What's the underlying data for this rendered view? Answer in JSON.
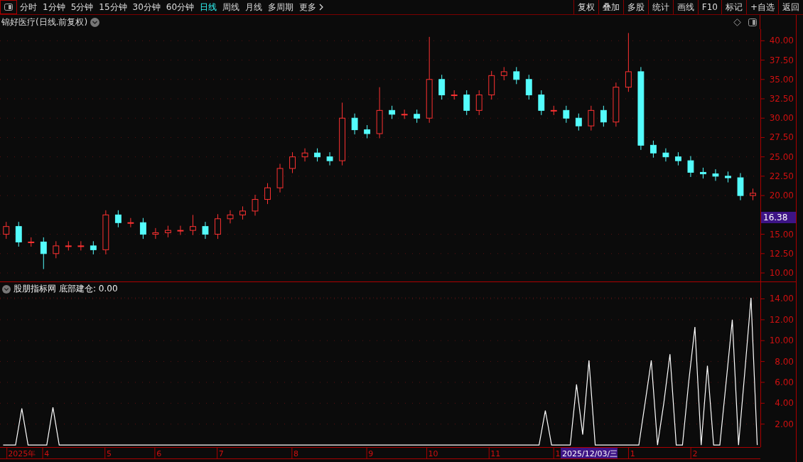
{
  "toolbar": {
    "tabs": [
      {
        "label": "分时",
        "selected": false,
        "kind": "tab"
      },
      {
        "label": "1分钟",
        "selected": false,
        "kind": "tab"
      },
      {
        "label": "5分钟",
        "selected": false,
        "kind": "tab"
      },
      {
        "label": "15分钟",
        "selected": false,
        "kind": "tab"
      },
      {
        "label": "30分钟",
        "selected": false,
        "kind": "tab"
      },
      {
        "label": "60分钟",
        "selected": false,
        "kind": "tab"
      },
      {
        "label": "日线",
        "selected": true,
        "kind": "tab"
      },
      {
        "label": "周线",
        "selected": false,
        "kind": "tab"
      },
      {
        "label": "月线",
        "selected": false,
        "kind": "tab"
      },
      {
        "label": "多周期",
        "selected": false,
        "kind": "tab"
      },
      {
        "label": "更多",
        "selected": false,
        "kind": "more"
      }
    ],
    "buttons": [
      "复权",
      "叠加",
      "多股",
      "统计",
      "画线",
      "F10",
      "标记",
      "+自选",
      "返回"
    ]
  },
  "price_panel": {
    "title": "锦好医疗(日线.前复权)",
    "current_price_tag": "16.38",
    "chart_data": {
      "type": "candlestick",
      "grid": true,
      "ylim": [
        8.9,
        41.5
      ],
      "yticks": [
        {
          "value": 10,
          "label": "10.00"
        },
        {
          "value": 12.5,
          "label": "12.50"
        },
        {
          "value": 15,
          "label": "15.00"
        },
        {
          "value": 20,
          "label": "20.00"
        },
        {
          "value": 22.5,
          "label": "22.50"
        },
        {
          "value": 25,
          "label": "25.00"
        },
        {
          "value": 27.5,
          "label": "27.50"
        },
        {
          "value": 30,
          "label": "30.00"
        },
        {
          "value": 32.5,
          "label": "32.50"
        },
        {
          "value": 35,
          "label": "35.00"
        },
        {
          "value": 37.5,
          "label": "37.50"
        },
        {
          "value": 40,
          "label": "40.00"
        }
      ],
      "categories": [
        null,
        null,
        null,
        null,
        null,
        null,
        null,
        null,
        null,
        null,
        null,
        null,
        null,
        null,
        null,
        null,
        null,
        null,
        null,
        null,
        null,
        null,
        null,
        null,
        null,
        null,
        null,
        null,
        null,
        null,
        null,
        null,
        null,
        null,
        null,
        null,
        null,
        null,
        null,
        null,
        null,
        null,
        null,
        null,
        null,
        null,
        null,
        null,
        null,
        null,
        null,
        null,
        null,
        null,
        null,
        null,
        null,
        null,
        null,
        null,
        null
      ],
      "ohlc": [
        [
          15,
          16.6,
          14.4,
          16
        ],
        [
          16,
          16.6,
          13.4,
          14
        ],
        [
          14,
          14.6,
          13.4,
          14
        ],
        [
          14,
          14.6,
          10.5,
          12.5
        ],
        [
          12.5,
          14.1,
          11.9,
          13.5
        ],
        [
          13.5,
          14.1,
          12.9,
          13.5
        ],
        [
          13.5,
          14.1,
          12.9,
          13.5
        ],
        [
          13.5,
          14.1,
          12.4,
          13
        ],
        [
          13,
          18.1,
          12.4,
          17.5
        ],
        [
          17.5,
          18.1,
          15.9,
          16.5
        ],
        [
          16.5,
          17.1,
          15.9,
          16.5
        ],
        [
          16.5,
          17.1,
          14.4,
          15
        ],
        [
          15,
          15.8,
          14.4,
          15.2
        ],
        [
          15.2,
          16.1,
          14.6,
          15.5
        ],
        [
          15.5,
          16.1,
          14.9,
          15.5
        ],
        [
          15.5,
          17.5,
          14.9,
          16
        ],
        [
          16,
          16.6,
          14.4,
          15
        ],
        [
          15,
          17.6,
          14.4,
          17
        ],
        [
          17,
          18.1,
          16.4,
          17.5
        ],
        [
          17.5,
          18.6,
          16.9,
          18
        ],
        [
          18,
          20.1,
          17.4,
          19.5
        ],
        [
          19.5,
          21.6,
          18.9,
          21
        ],
        [
          21,
          24.1,
          20.4,
          23.5
        ],
        [
          23.5,
          25.6,
          22.9,
          25
        ],
        [
          25,
          26.1,
          24.4,
          25.5
        ],
        [
          25.5,
          26.1,
          24.4,
          25
        ],
        [
          25,
          25.6,
          23.9,
          24.5
        ],
        [
          24.5,
          32,
          23.9,
          30
        ],
        [
          30,
          30.6,
          27.9,
          28.5
        ],
        [
          28.5,
          29.1,
          27.4,
          28
        ],
        [
          28,
          34,
          27.4,
          31
        ],
        [
          31,
          31.6,
          29.9,
          30.5
        ],
        [
          30.5,
          31.1,
          29.9,
          30.5
        ],
        [
          30.5,
          31.1,
          29.4,
          30
        ],
        [
          30,
          40.5,
          29.4,
          35
        ],
        [
          35,
          35.6,
          32.4,
          33
        ],
        [
          33,
          33.6,
          32.4,
          33
        ],
        [
          33,
          33.6,
          30.4,
          31
        ],
        [
          31,
          33.6,
          30.4,
          33
        ],
        [
          33,
          36.1,
          32.4,
          35.5
        ],
        [
          35.5,
          36.6,
          34.9,
          36
        ],
        [
          36,
          36.6,
          34.4,
          35
        ],
        [
          35,
          35.6,
          32.4,
          33
        ],
        [
          33,
          33.6,
          30.4,
          31
        ],
        [
          31,
          31.6,
          30.4,
          31
        ],
        [
          31,
          31.6,
          29.4,
          30
        ],
        [
          30,
          30.6,
          28.4,
          29
        ],
        [
          29,
          31.6,
          28.4,
          31
        ],
        [
          31,
          31.6,
          28.9,
          29.5
        ],
        [
          29.5,
          34.6,
          28.9,
          34
        ],
        [
          34,
          41,
          33.4,
          36
        ],
        [
          36,
          36.6,
          25.9,
          26.5
        ],
        [
          26.5,
          27.1,
          24.9,
          25.5
        ],
        [
          25.5,
          26.1,
          24.4,
          25
        ],
        [
          25,
          25.6,
          23.9,
          24.5
        ],
        [
          24.5,
          25.1,
          22.4,
          23
        ],
        [
          23,
          23.6,
          22.2,
          22.8
        ],
        [
          22.8,
          23.4,
          21.9,
          22.5
        ],
        [
          22.5,
          23.1,
          21.7,
          22.3
        ],
        [
          22.3,
          22.9,
          19.4,
          20
        ],
        [
          20,
          20.9,
          19.4,
          20.3
        ]
      ]
    }
  },
  "indicator_panel": {
    "name": "股朋指标网",
    "formula": "底部建仓: 0.00",
    "chart_data": {
      "type": "line",
      "grid": true,
      "ylim": [
        -0.2,
        15.6
      ],
      "yticks": [
        {
          "value": 2,
          "label": "2.00"
        },
        {
          "value": 4,
          "label": "4.00"
        },
        {
          "value": 6,
          "label": "6.00"
        },
        {
          "value": 8,
          "label": "8.00"
        },
        {
          "value": 10,
          "label": "10.00"
        },
        {
          "value": 12,
          "label": "12.00"
        },
        {
          "value": 14,
          "label": "14.00"
        }
      ],
      "categories": [
        null,
        null,
        null,
        "2025年",
        null,
        null,
        null,
        "4",
        null,
        null,
        null,
        null,
        null,
        null,
        null,
        null,
        null,
        "5",
        null,
        null,
        null,
        null,
        null,
        null,
        null,
        "6",
        null,
        null,
        null,
        null,
        null,
        null,
        null,
        null,
        null,
        "7",
        null,
        null,
        null,
        null,
        null,
        null,
        null,
        null,
        null,
        null,
        null,
        "8",
        null,
        null,
        null,
        null,
        null,
        null,
        null,
        null,
        null,
        null,
        null,
        "9",
        null,
        null,
        null,
        null,
        null,
        null,
        null,
        null,
        null,
        "10",
        null,
        null,
        null,
        null,
        null,
        null,
        null,
        null,
        null,
        "11",
        null,
        null,
        null,
        null,
        null,
        null,
        null,
        null,
        null,
        "1",
        null,
        null,
        null,
        null,
        null,
        null,
        null,
        null,
        null,
        null,
        null,
        "1",
        null,
        null,
        null,
        null,
        null,
        null,
        null,
        null,
        null,
        "2",
        null,
        null,
        null,
        null,
        null,
        null,
        null,
        null,
        null,
        null
      ],
      "series": [
        {
          "color": "#ffffff",
          "values": [
            0,
            0,
            0,
            3.5,
            0,
            0,
            0,
            0,
            3.6,
            0,
            0,
            0,
            0,
            0,
            0,
            0,
            0,
            0,
            0,
            0,
            0,
            0,
            0,
            0,
            0,
            0,
            0,
            0,
            0,
            0,
            0,
            0,
            0,
            0,
            0,
            0,
            0,
            0,
            0,
            0,
            0,
            0,
            0,
            0,
            0,
            0,
            0,
            0,
            0,
            0,
            0,
            0,
            0,
            0,
            0,
            0,
            0,
            0,
            0,
            0,
            0,
            0,
            0,
            0,
            0,
            0,
            0,
            0,
            0,
            0,
            0,
            0,
            0,
            0,
            0,
            0,
            0,
            0,
            0,
            0,
            0,
            0,
            0,
            0,
            0,
            0,
            0,
            3.3,
            0,
            0,
            0,
            0,
            5.8,
            1,
            8.1,
            0,
            0,
            0,
            0,
            0,
            0,
            0,
            0,
            4,
            8.1,
            0,
            4,
            8.7,
            0,
            0,
            6,
            11.3,
            0,
            7.6,
            0,
            0,
            6,
            12,
            0,
            7,
            14.1,
            0
          ]
        }
      ]
    }
  },
  "cursor_date": "2025/12/03/三"
}
